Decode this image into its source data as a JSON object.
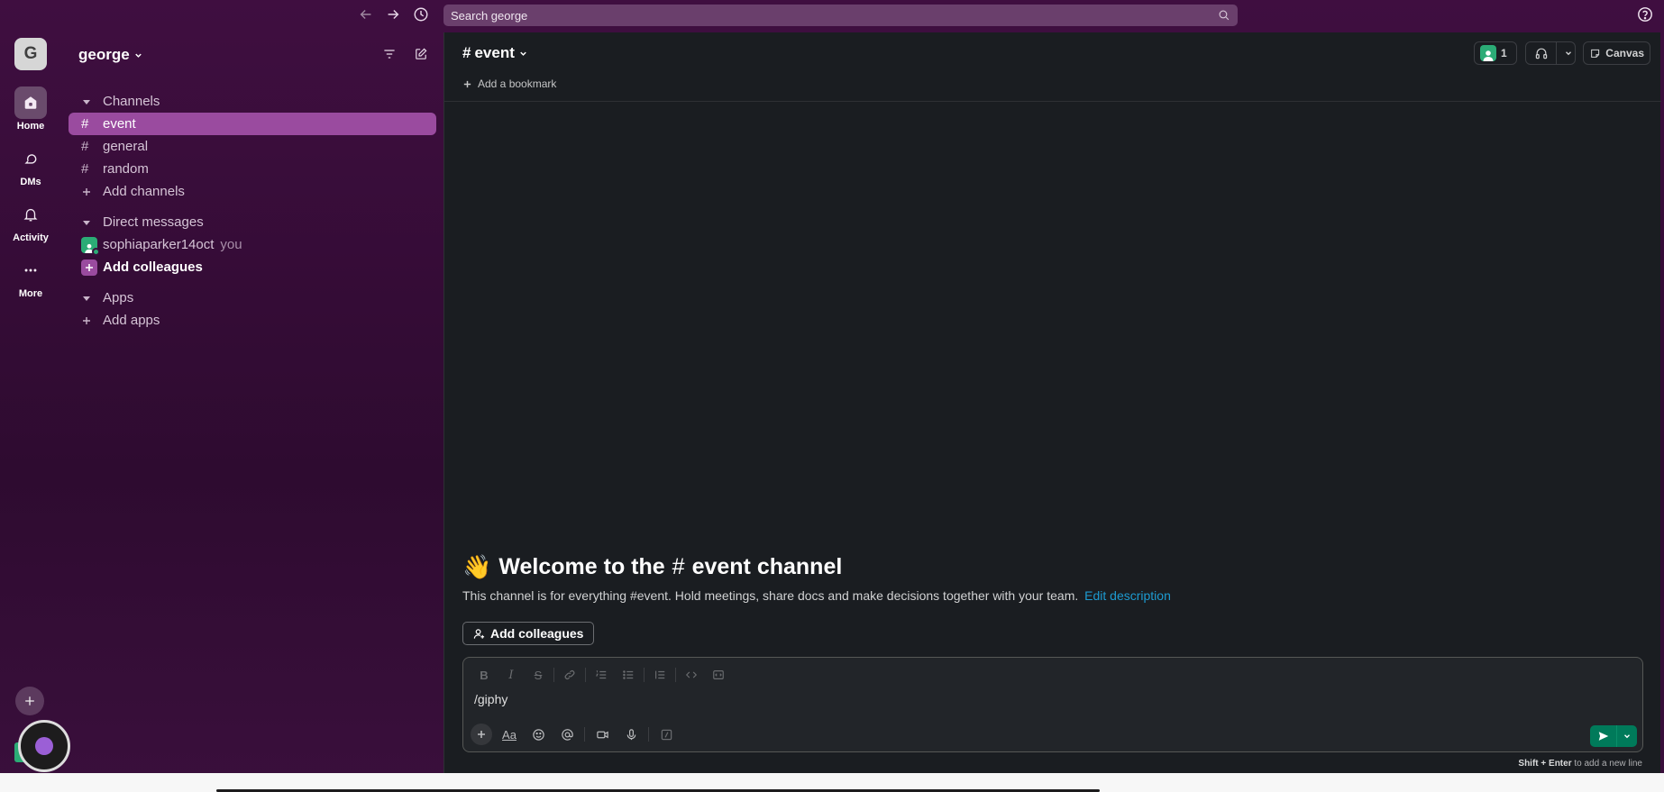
{
  "topbar": {
    "search_placeholder": "Search george"
  },
  "rail": {
    "workspace_initial": "G",
    "items": [
      {
        "label": "Home",
        "icon": "home-icon"
      },
      {
        "label": "DMs",
        "icon": "dms-icon"
      },
      {
        "label": "Activity",
        "icon": "bell-icon"
      },
      {
        "label": "More",
        "icon": "ellipsis-icon"
      }
    ]
  },
  "sidebar": {
    "workspace_name": "george",
    "sections": {
      "channels_title": "Channels",
      "channels": [
        "event",
        "general",
        "random"
      ],
      "add_channels": "Add channels",
      "dms_title": "Direct messages",
      "dm_user": "sophiaparker14oct",
      "dm_you": "you",
      "add_colleagues": "Add colleagues",
      "apps_title": "Apps",
      "add_apps": "Add apps"
    }
  },
  "main": {
    "channel_name": "event",
    "member_count": "1",
    "canvas_label": "Canvas",
    "add_bookmark": "Add a bookmark",
    "welcome_prefix": "Welcome to the",
    "welcome_channel": "event channel",
    "welcome_desc": "This channel is for everything #event. Hold meetings, share docs and make decisions together with your team.",
    "edit_description": "Edit description",
    "add_colleagues_btn": "Add colleagues",
    "composer_text": "/giphy",
    "hint_key": "Shift + Enter",
    "hint_rest": "to add a new line"
  },
  "colors": {
    "sidebar_bg": "#3f0e40",
    "active_channel": "#9a4b9f",
    "main_bg": "#1a1d21",
    "link": "#1d9bd1",
    "send": "#007a5a",
    "presence": "#2bac76"
  }
}
